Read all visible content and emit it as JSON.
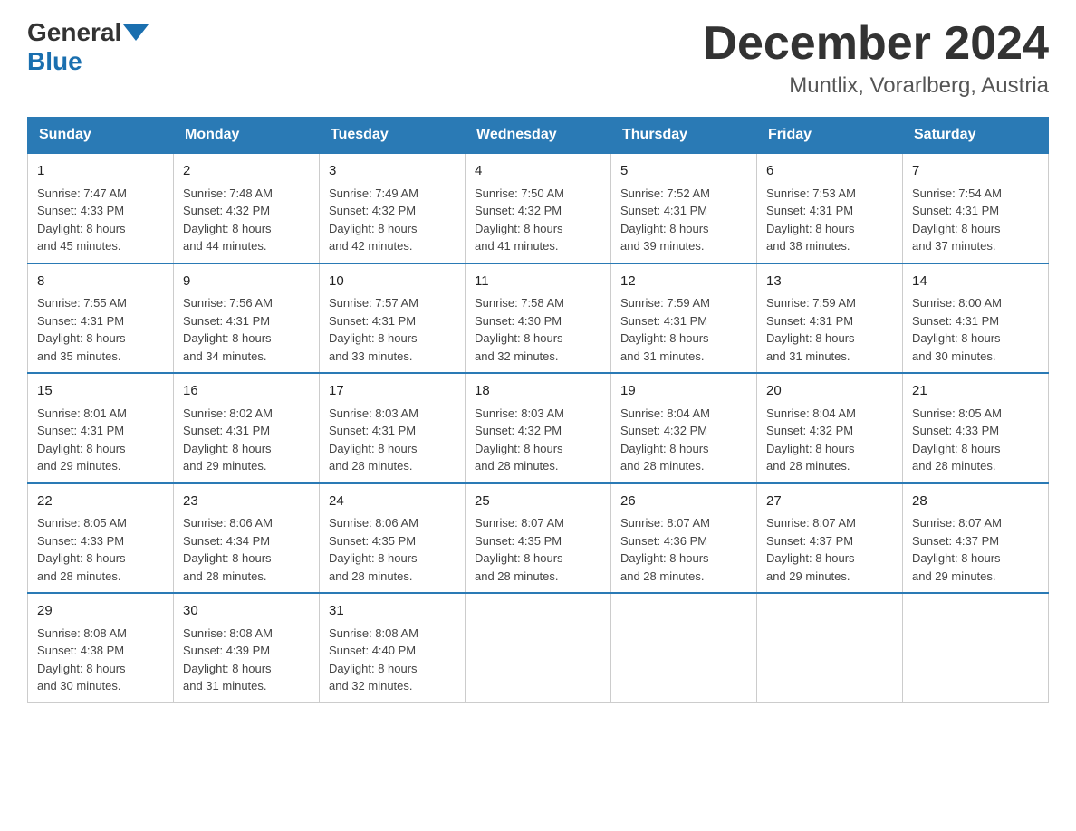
{
  "header": {
    "logo_general": "General",
    "logo_blue": "Blue",
    "title": "December 2024",
    "subtitle": "Muntlix, Vorarlberg, Austria"
  },
  "days_of_week": [
    "Sunday",
    "Monday",
    "Tuesday",
    "Wednesday",
    "Thursday",
    "Friday",
    "Saturday"
  ],
  "weeks": [
    [
      {
        "day": "1",
        "sunrise": "7:47 AM",
        "sunset": "4:33 PM",
        "daylight": "8 hours and 45 minutes."
      },
      {
        "day": "2",
        "sunrise": "7:48 AM",
        "sunset": "4:32 PM",
        "daylight": "8 hours and 44 minutes."
      },
      {
        "day": "3",
        "sunrise": "7:49 AM",
        "sunset": "4:32 PM",
        "daylight": "8 hours and 42 minutes."
      },
      {
        "day": "4",
        "sunrise": "7:50 AM",
        "sunset": "4:32 PM",
        "daylight": "8 hours and 41 minutes."
      },
      {
        "day": "5",
        "sunrise": "7:52 AM",
        "sunset": "4:31 PM",
        "daylight": "8 hours and 39 minutes."
      },
      {
        "day": "6",
        "sunrise": "7:53 AM",
        "sunset": "4:31 PM",
        "daylight": "8 hours and 38 minutes."
      },
      {
        "day": "7",
        "sunrise": "7:54 AM",
        "sunset": "4:31 PM",
        "daylight": "8 hours and 37 minutes."
      }
    ],
    [
      {
        "day": "8",
        "sunrise": "7:55 AM",
        "sunset": "4:31 PM",
        "daylight": "8 hours and 35 minutes."
      },
      {
        "day": "9",
        "sunrise": "7:56 AM",
        "sunset": "4:31 PM",
        "daylight": "8 hours and 34 minutes."
      },
      {
        "day": "10",
        "sunrise": "7:57 AM",
        "sunset": "4:31 PM",
        "daylight": "8 hours and 33 minutes."
      },
      {
        "day": "11",
        "sunrise": "7:58 AM",
        "sunset": "4:30 PM",
        "daylight": "8 hours and 32 minutes."
      },
      {
        "day": "12",
        "sunrise": "7:59 AM",
        "sunset": "4:31 PM",
        "daylight": "8 hours and 31 minutes."
      },
      {
        "day": "13",
        "sunrise": "7:59 AM",
        "sunset": "4:31 PM",
        "daylight": "8 hours and 31 minutes."
      },
      {
        "day": "14",
        "sunrise": "8:00 AM",
        "sunset": "4:31 PM",
        "daylight": "8 hours and 30 minutes."
      }
    ],
    [
      {
        "day": "15",
        "sunrise": "8:01 AM",
        "sunset": "4:31 PM",
        "daylight": "8 hours and 29 minutes."
      },
      {
        "day": "16",
        "sunrise": "8:02 AM",
        "sunset": "4:31 PM",
        "daylight": "8 hours and 29 minutes."
      },
      {
        "day": "17",
        "sunrise": "8:03 AM",
        "sunset": "4:31 PM",
        "daylight": "8 hours and 28 minutes."
      },
      {
        "day": "18",
        "sunrise": "8:03 AM",
        "sunset": "4:32 PM",
        "daylight": "8 hours and 28 minutes."
      },
      {
        "day": "19",
        "sunrise": "8:04 AM",
        "sunset": "4:32 PM",
        "daylight": "8 hours and 28 minutes."
      },
      {
        "day": "20",
        "sunrise": "8:04 AM",
        "sunset": "4:32 PM",
        "daylight": "8 hours and 28 minutes."
      },
      {
        "day": "21",
        "sunrise": "8:05 AM",
        "sunset": "4:33 PM",
        "daylight": "8 hours and 28 minutes."
      }
    ],
    [
      {
        "day": "22",
        "sunrise": "8:05 AM",
        "sunset": "4:33 PM",
        "daylight": "8 hours and 28 minutes."
      },
      {
        "day": "23",
        "sunrise": "8:06 AM",
        "sunset": "4:34 PM",
        "daylight": "8 hours and 28 minutes."
      },
      {
        "day": "24",
        "sunrise": "8:06 AM",
        "sunset": "4:35 PM",
        "daylight": "8 hours and 28 minutes."
      },
      {
        "day": "25",
        "sunrise": "8:07 AM",
        "sunset": "4:35 PM",
        "daylight": "8 hours and 28 minutes."
      },
      {
        "day": "26",
        "sunrise": "8:07 AM",
        "sunset": "4:36 PM",
        "daylight": "8 hours and 28 minutes."
      },
      {
        "day": "27",
        "sunrise": "8:07 AM",
        "sunset": "4:37 PM",
        "daylight": "8 hours and 29 minutes."
      },
      {
        "day": "28",
        "sunrise": "8:07 AM",
        "sunset": "4:37 PM",
        "daylight": "8 hours and 29 minutes."
      }
    ],
    [
      {
        "day": "29",
        "sunrise": "8:08 AM",
        "sunset": "4:38 PM",
        "daylight": "8 hours and 30 minutes."
      },
      {
        "day": "30",
        "sunrise": "8:08 AM",
        "sunset": "4:39 PM",
        "daylight": "8 hours and 31 minutes."
      },
      {
        "day": "31",
        "sunrise": "8:08 AM",
        "sunset": "4:40 PM",
        "daylight": "8 hours and 32 minutes."
      },
      null,
      null,
      null,
      null
    ]
  ],
  "labels": {
    "sunrise": "Sunrise:",
    "sunset": "Sunset:",
    "daylight": "Daylight:"
  }
}
